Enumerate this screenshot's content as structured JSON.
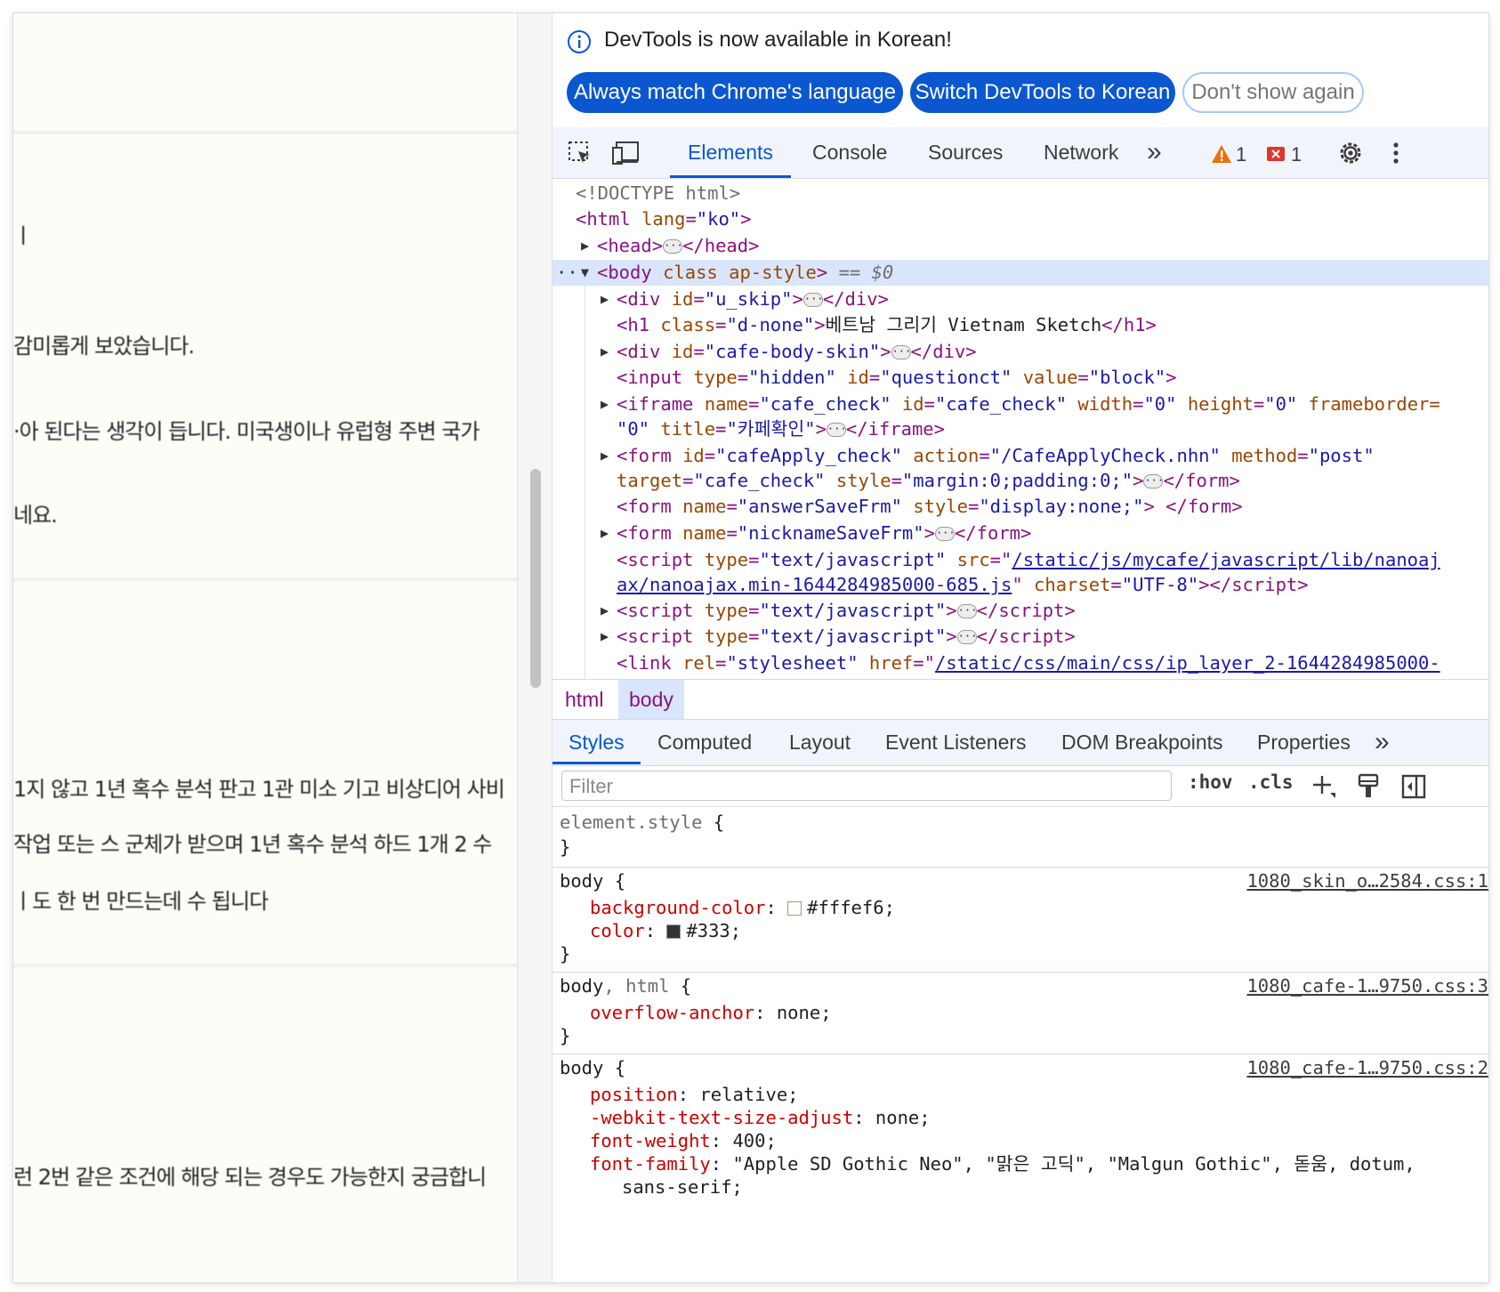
{
  "page": {
    "lines": [
      "ㅣ",
      "감미롭게 보았습니다.",
      "·아 된다는 생각이 듭니다. 미국생이나 유럽형 주변 국가",
      "네요.",
      "1지 않고 1년 혹수 분석 판고 1관 미소 기고 비상디어 사비",
      "작업 또는 스 군체가 받으며 1년 혹수 분석 하드 1개 2 수",
      "ㅣ도 한 번 만드는데 수 됩니다",
      "런 2번 같은 조건에 해당 되는 경우도 가능한지 궁금합니"
    ]
  },
  "banner": {
    "message": "DevTools is now available in Korean!",
    "btn_match": "Always match Chrome's language",
    "btn_switch": "Switch DevTools to Korean",
    "btn_dismiss": "Don't show again"
  },
  "toolbar": {
    "tabs": [
      "Elements",
      "Console",
      "Sources",
      "Network"
    ],
    "more": "»",
    "warnings": "1",
    "errors": "1"
  },
  "elements": {
    "doctype": "<!DOCTYPE html>",
    "html_open": "<html",
    "lang_attr": "lang",
    "lang_val": "\"ko\"",
    "head": "<head>",
    "head_close": "</head>",
    "body_open": "<body",
    "body_class": "class",
    "body_class_val": "ap-style",
    "selected_marker": "== $0",
    "row_div_uskip_attr": "id",
    "row_div_uskip_val": "\"u_skip\"",
    "h1_class_val": "\"d-none\"",
    "h1_text": "베트남 그리기 Vietnam Sketch",
    "div_skin_val": "\"cafe-body-skin\"",
    "input_type_val": "\"hidden\"",
    "input_id_val": "\"questionct\"",
    "input_value_val": "\"block\"",
    "iframe_name_val": "\"cafe_check\"",
    "iframe_id_val": "\"cafe_check\"",
    "iframe_width_val": "\"0\"",
    "iframe_height_val": "\"0\"",
    "iframe_frameborder": "frameborder=",
    "iframe_fb_val": "\"0\"",
    "iframe_title_val": "\"카페확인\"",
    "form1_id_val": "\"cafeApply_check\"",
    "form1_action_val": "\"/CafeApplyCheck.nhn\"",
    "form1_method_val": "\"post\"",
    "form1_target_val": "\"cafe_check\"",
    "form1_style_val": "\"margin:0;padding:0;\"",
    "form2_name_val": "\"answerSaveFrm\"",
    "form2_style_val": "\"display:none;\"",
    "form3_name_val": "\"nicknameSaveFrm\"",
    "script_type_val": "\"text/javascript\"",
    "script_src_part1": "/static/js/mycafe/javascript/lib/nanoaj",
    "script_src_part2": "ax/nanoajax.min-1644284985000-685.js",
    "script_charset_val": "\"UTF-8\"",
    "link_rel_val": "\"stylesheet\"",
    "link_href": "/static/css/main/css/ip_layer_2-1644284985000-"
  },
  "breadcrumbs": [
    "html",
    "body"
  ],
  "subtabs": [
    "Styles",
    "Computed",
    "Layout",
    "Event Listeners",
    "DOM Breakpoints",
    "Properties"
  ],
  "filter": {
    "placeholder": "Filter",
    "hov": ":hov",
    "cls": ".cls"
  },
  "styles": {
    "element_style": "element.style",
    "rule1": {
      "selector": "body",
      "source": "1080_skin_o…2584.css:1",
      "bg_prop": "background-color",
      "bg_val": "#fffef6;",
      "color_prop": "color",
      "color_val": "#333;",
      "swatch_bg": "#fffef6",
      "swatch_color": "#333333"
    },
    "rule2": {
      "selector_a": "body",
      "selector_b": "html",
      "source": "1080_cafe-1…9750.css:3",
      "prop": "overflow-anchor",
      "val": "none;"
    },
    "rule3": {
      "selector": "body",
      "source": "1080_cafe-1…9750.css:2",
      "p1": "position",
      "v1": "relative;",
      "p2": "-webkit-text-size-adjust",
      "v2": "none;",
      "p3": "font-weight",
      "v3": "400;",
      "p4": "font-family",
      "v4": "\"Apple SD Gothic Neo\", \"맑은 고딕\", \"Malgun Gothic\", 돋움, dotum,",
      "v4b": "sans-serif;"
    }
  },
  "colors": {
    "accent": "#0b57d0",
    "tag": "#881280",
    "attr_name": "#994500",
    "attr_val": "#1a1aa6",
    "prop": "#c80000"
  }
}
